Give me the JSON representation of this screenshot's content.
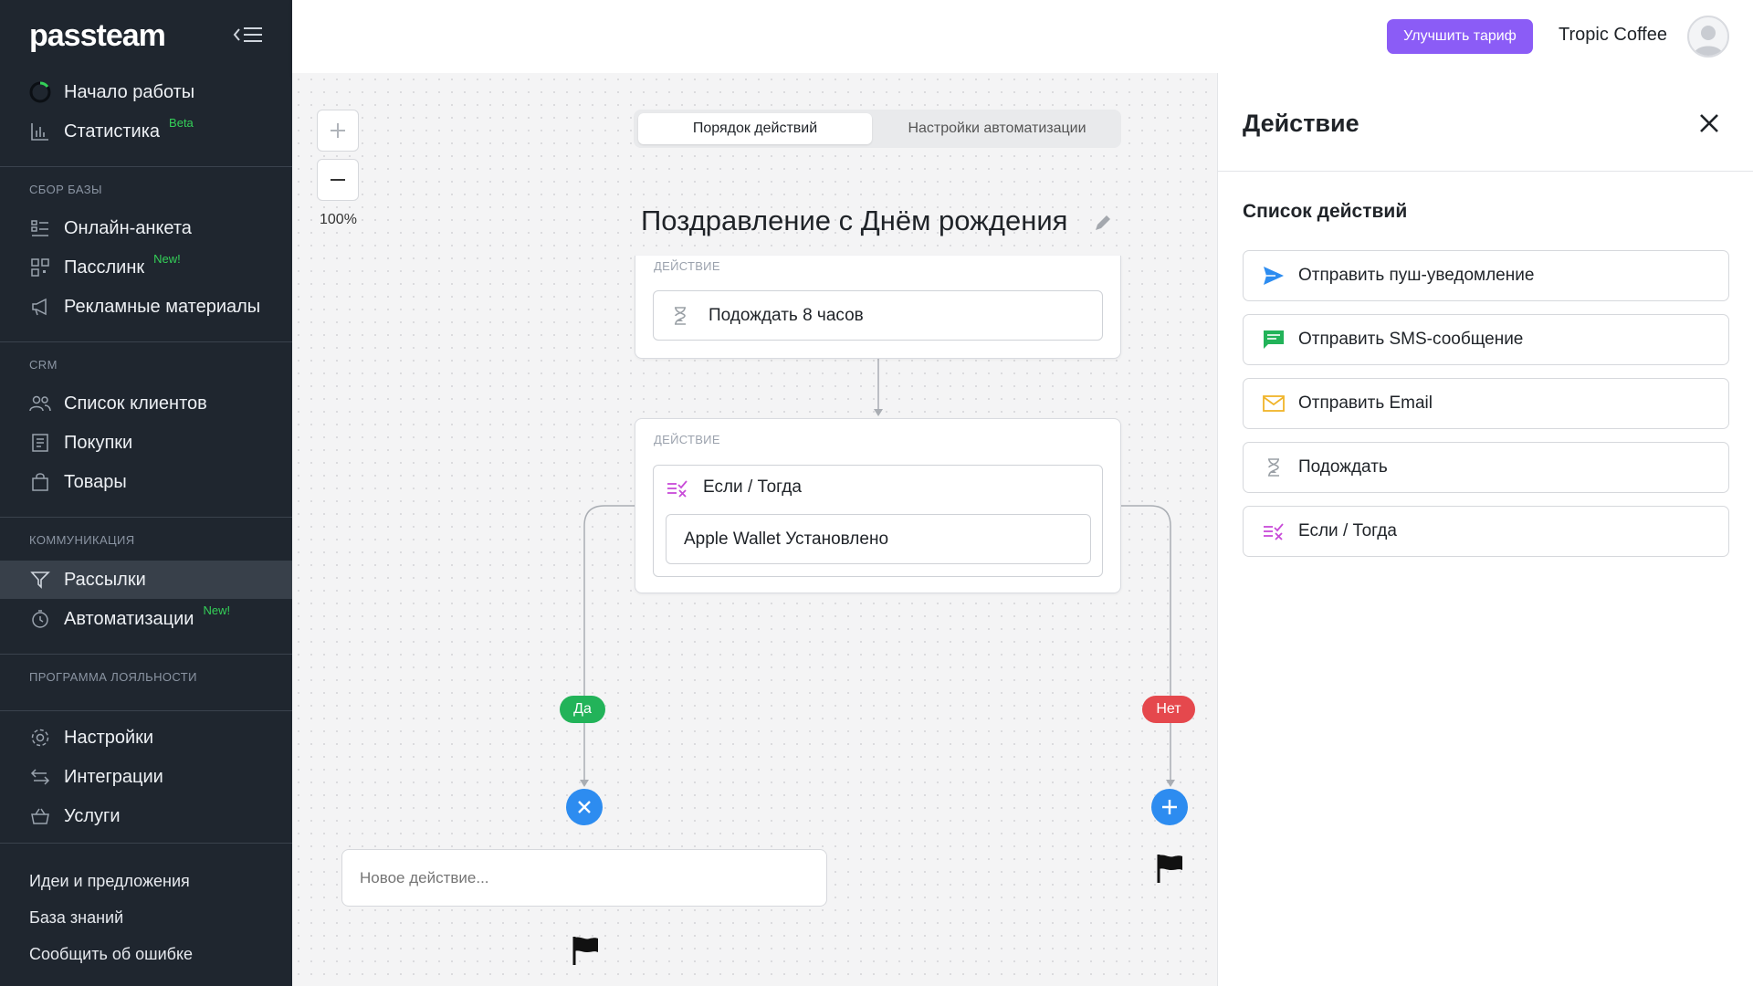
{
  "brand": "passteam",
  "sidebar": {
    "top_items": [
      {
        "label": "Начало работы",
        "icon": "progress-ring-icon"
      },
      {
        "label": "Статистика",
        "tag": "Beta",
        "icon": "bar-chart-icon"
      }
    ],
    "sections": [
      {
        "title": "Сбор базы",
        "items": [
          {
            "label": "Онлайн-анкета",
            "icon": "form-icon"
          },
          {
            "label": "Пасслинк",
            "tag": "New!",
            "icon": "qr-code-icon"
          },
          {
            "label": "Рекламные материалы",
            "icon": "megaphone-icon"
          }
        ]
      },
      {
        "title": "CRM",
        "items": [
          {
            "label": "Список клиентов",
            "icon": "users-icon"
          },
          {
            "label": "Покупки",
            "icon": "receipt-icon"
          },
          {
            "label": "Товары",
            "icon": "shopping-bag-icon"
          }
        ]
      },
      {
        "title": "Коммуникация",
        "items": [
          {
            "label": "Рассылки",
            "icon": "send-icon",
            "active": true
          },
          {
            "label": "Автоматизации",
            "tag": "New!",
            "icon": "automation-icon"
          }
        ]
      },
      {
        "title": "Программа лояльности",
        "items": []
      }
    ],
    "bottom_items": [
      {
        "label": "Настройки",
        "icon": "gear-icon"
      },
      {
        "label": "Интеграции",
        "icon": "arrows-exchange-icon"
      },
      {
        "label": "Услуги",
        "icon": "basket-icon"
      }
    ],
    "footer_links": [
      "Идеи и предложения",
      "База знаний",
      "Сообщить об ошибке"
    ]
  },
  "topbar": {
    "upgrade_label": "Улучшить тариф",
    "company": "Tropic Coffee"
  },
  "canvas": {
    "zoom_level": "100%",
    "tabs": [
      "Порядок действий",
      "Настройки автоматизации"
    ],
    "active_tab": 0,
    "title": "Поздравление с Днём рождения",
    "card1": {
      "caption": "Действие",
      "action": "Подождать 8 часов"
    },
    "card2": {
      "caption": "Действие",
      "action": "Если / Тогда",
      "condition": "Apple Wallet Установлено"
    },
    "branch_yes": "Да",
    "branch_no": "Нет",
    "new_action_placeholder": "Новое действие..."
  },
  "panel": {
    "title": "Действие",
    "list_title": "Список действий",
    "actions": [
      {
        "label": "Отправить пуш-уведомление",
        "icon": "paper-plane-icon",
        "color": "#2d8cf0"
      },
      {
        "label": "Отправить SMS-сообщение",
        "icon": "message-icon",
        "color": "#22b359"
      },
      {
        "label": "Отправить Email",
        "icon": "envelope-icon",
        "color": "#f0b429"
      },
      {
        "label": "Подождать",
        "icon": "hourglass-icon",
        "color": "#9aa0a6"
      },
      {
        "label": "Если / Тогда",
        "icon": "condition-icon",
        "color": "#c84bd8"
      }
    ]
  },
  "colors": {
    "sidebar_bg": "#1f262f",
    "accent_purple": "#8b5cf6",
    "yes_green": "#22b359",
    "no_red": "#e5484d",
    "action_blue": "#2d8cf0",
    "new_tag_green": "#34d058"
  }
}
